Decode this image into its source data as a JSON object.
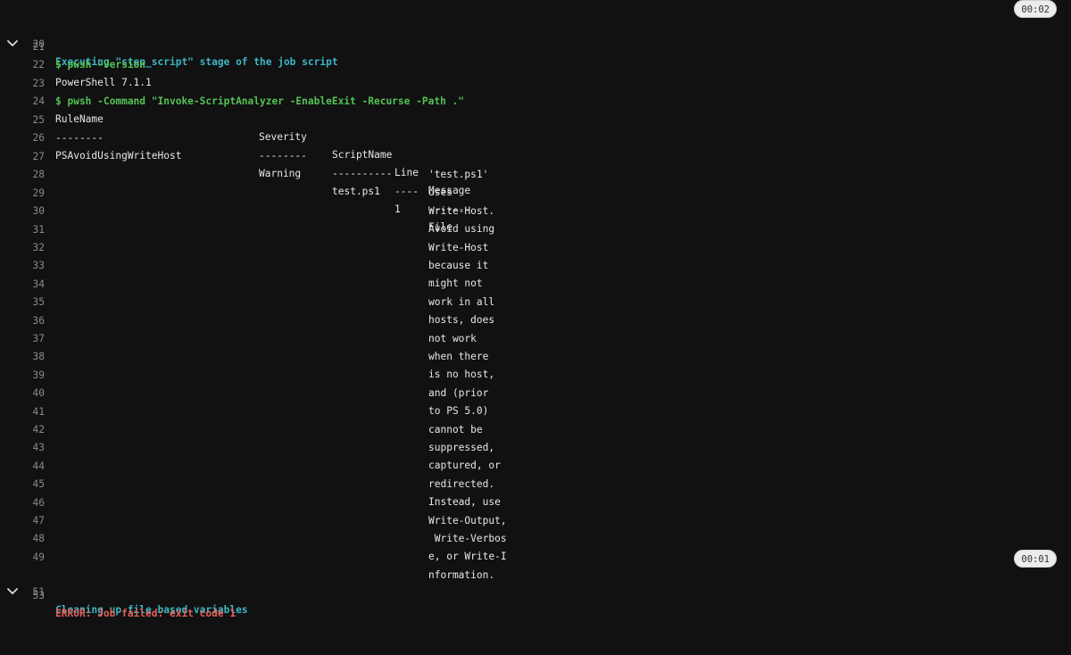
{
  "colors": {
    "background": "#111111",
    "section": "#3fb5c2",
    "command": "#54c254",
    "error": "#e0605a",
    "line_number": "#8a8a8a",
    "text": "#e8e8e8"
  },
  "icons": {
    "collapse": "chevron-down-icon"
  },
  "sections": {
    "step_script": {
      "line": "20",
      "title": "Executing \"step_script\" stage of the job script",
      "duration": "00:02"
    },
    "cleanup": {
      "line": "51",
      "title": "Cleaning up file based variables",
      "duration": "00:01"
    }
  },
  "lines": {
    "l21": {
      "num": "21",
      "text": "$ pwsh -Version"
    },
    "l22": {
      "num": "22",
      "text": "PowerShell 7.1.1"
    },
    "l23": {
      "num": "23",
      "text": "$ pwsh -Command \"Invoke-ScriptAnalyzer -EnableExit -Recurse -Path .\""
    },
    "l53": {
      "num": "53",
      "text": "ERROR: Job failed: exit code 1"
    }
  },
  "table": {
    "header_line": "24",
    "headers": [
      "RuleName",
      "Severity",
      "ScriptName",
      "Line",
      "Message"
    ],
    "separator_line": "25",
    "separators": [
      "--------",
      "--------",
      "----------",
      "----",
      "-------"
    ],
    "row": {
      "line": "26",
      "rule_name": "PSAvoidUsingWriteHost",
      "severity": "Warning",
      "script_name": "test.ps1",
      "line_value": "1"
    },
    "message_lines": [
      {
        "num": "26",
        "text": "File"
      },
      {
        "num": "27",
        "text": "'test.ps1'"
      },
      {
        "num": "28",
        "text": "uses"
      },
      {
        "num": "29",
        "text": "Write-Host."
      },
      {
        "num": "30",
        "text": "Avoid using"
      },
      {
        "num": "31",
        "text": "Write-Host"
      },
      {
        "num": "32",
        "text": "because it"
      },
      {
        "num": "33",
        "text": "might not"
      },
      {
        "num": "34",
        "text": "work in all"
      },
      {
        "num": "35",
        "text": "hosts, does"
      },
      {
        "num": "36",
        "text": "not work"
      },
      {
        "num": "37",
        "text": "when there"
      },
      {
        "num": "38",
        "text": "is no host,"
      },
      {
        "num": "39",
        "text": "and (prior"
      },
      {
        "num": "40",
        "text": "to PS 5.0)"
      },
      {
        "num": "41",
        "text": "cannot be"
      },
      {
        "num": "42",
        "text": "suppressed,"
      },
      {
        "num": "43",
        "text": "captured, or"
      },
      {
        "num": "44",
        "text": "redirected."
      },
      {
        "num": "45",
        "text": "Instead, use"
      },
      {
        "num": "46",
        "text": "Write-Output,"
      },
      {
        "num": "47",
        "text": " Write-Verbos"
      },
      {
        "num": "48",
        "text": "e, or Write-I"
      },
      {
        "num": "49",
        "text": "nformation."
      }
    ]
  }
}
